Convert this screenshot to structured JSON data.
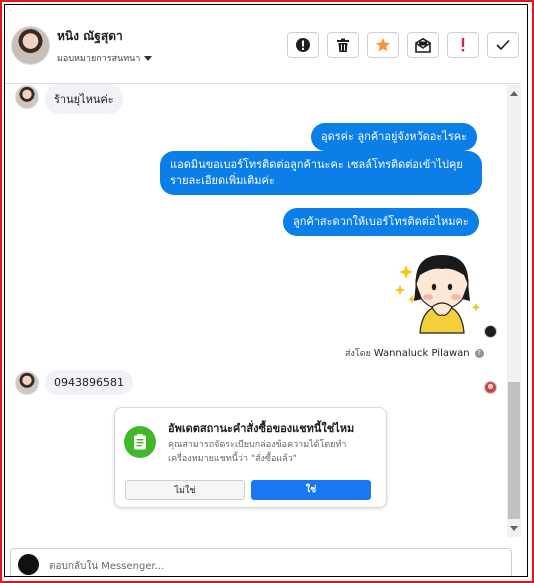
{
  "header": {
    "contact_name": "หนิง ณัฐสุดา",
    "assign_label": "มอบหมายการสนทนา",
    "actions": [
      "alert-icon",
      "trash-icon",
      "star-icon",
      "mail-icon",
      "exclamation-icon",
      "check-icon"
    ]
  },
  "messages": {
    "incoming_1": "ร้านยุไหนค่ะ",
    "outgoing_1": "อุดรค่ะ  ลูกค้าอยู่จังหวัดอะไรคะ",
    "outgoing_2": "แอดมินขอเบอร์โทรติดต่อลูกค้านะคะ เซลล์โทรติดต่อเข้าไปคุยรายละเอียดเพิ่มเติมค่ะ",
    "outgoing_3": "ลูกค้าสะดวกให้เบอร์โทรติดต่อไหมคะ",
    "sent_by_prefix": "ส่งโดย",
    "sent_by_name": "Wannaluck Pilawan",
    "incoming_2": "0943896581"
  },
  "order_card": {
    "title": "อัพเดตสถานะคำสั่งซื้อของแชทนี้ใช่ไหม",
    "text": "คุณสามารถจัดระเบียบกล่องข้อความได้โดยทำเครื่องหมายแชทนี้ว่า \"สั่งซื้อแล้ว\"",
    "no_label": "ไม่ใช่",
    "yes_label": "ใช่"
  },
  "composer": {
    "placeholder": "ตอบกลับใน Messenger..."
  },
  "colors": {
    "outgoing_bubble": "#0b7ee8",
    "incoming_bubble": "#f0f2f5",
    "primary": "#1877f2",
    "order_icon": "#42b72a",
    "star": "#f7923b",
    "alert": "#e41e3f",
    "frame": "#e4151f"
  }
}
